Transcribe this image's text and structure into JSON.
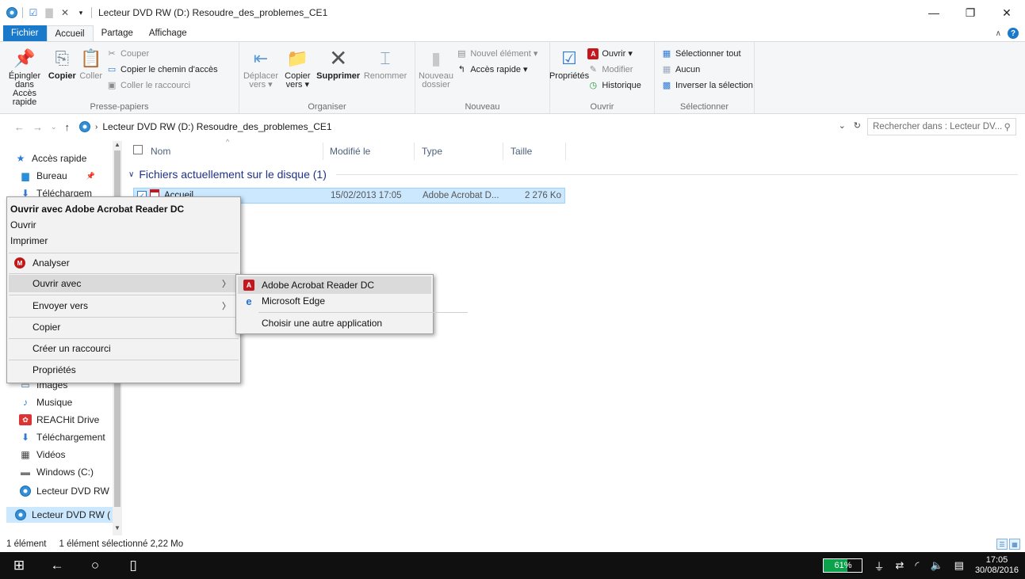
{
  "window": {
    "title": "Lecteur DVD RW (D:) Resoudre_des_problemes_CE1",
    "controls": {
      "minimize": "—",
      "maximize": "❐",
      "close": "✕"
    }
  },
  "tabs": [
    {
      "label": "Fichier"
    },
    {
      "label": "Accueil"
    },
    {
      "label": "Partage"
    },
    {
      "label": "Affichage"
    }
  ],
  "ribbon": {
    "clipboard": {
      "label": "Presse-papiers",
      "pin": "Épingler dans Accès rapide",
      "copy": "Copier",
      "paste": "Coller",
      "cut": "Couper",
      "copy_path": "Copier le chemin d'accès",
      "paste_shortcut": "Coller le raccourci"
    },
    "organize": {
      "label": "Organiser",
      "move": "Déplacer vers ▾",
      "copy_to": "Copier vers ▾",
      "delete": "Supprimer",
      "rename": "Renommer"
    },
    "new": {
      "label": "Nouveau",
      "new_folder": "Nouveau dossier",
      "new_item": "Nouvel élément ▾",
      "quick_access": "Accès rapide ▾"
    },
    "open": {
      "label": "Ouvrir",
      "properties": "Propriétés",
      "open": "Ouvrir ▾",
      "edit": "Modifier",
      "history": "Historique"
    },
    "select": {
      "label": "Sélectionner",
      "select_all": "Sélectionner tout",
      "select_none": "Aucun",
      "invert": "Inverser la sélection"
    }
  },
  "address": {
    "path": "Lecteur DVD RW (D:) Resoudre_des_problemes_CE1",
    "search_placeholder": "Rechercher dans : Lecteur DV..."
  },
  "nav_pane": [
    {
      "label": "Accès rapide"
    },
    {
      "label": "Bureau"
    },
    {
      "label": "Téléchargem"
    },
    {
      "label": "Images"
    },
    {
      "label": "Musique"
    },
    {
      "label": "REACHit Drive"
    },
    {
      "label": "Téléchargement"
    },
    {
      "label": "Vidéos"
    },
    {
      "label": "Windows (C:)"
    },
    {
      "label": "Lecteur DVD RW"
    },
    {
      "label": "Lecteur DVD RW ("
    }
  ],
  "columns": {
    "name": "Nom",
    "modified": "Modifié le",
    "type": "Type",
    "size": "Taille"
  },
  "group": {
    "label": "Fichiers actuellement sur le disque (1)"
  },
  "file": {
    "name": "Accueil",
    "modified": "15/02/2013 17:05",
    "type": "Adobe Acrobat D...",
    "size": "2 276 Ko"
  },
  "context_menu": {
    "open_with_default": "Ouvrir avec Adobe Acrobat Reader DC",
    "open": "Ouvrir",
    "print": "Imprimer",
    "scan": "Analyser",
    "open_with": "Ouvrir avec",
    "send_to": "Envoyer vers",
    "copy": "Copier",
    "create_shortcut": "Créer un raccourci",
    "properties": "Propriétés"
  },
  "submenu": {
    "acrobat": "Adobe Acrobat Reader DC",
    "edge": "Microsoft Edge",
    "other": "Choisir une autre application"
  },
  "status": {
    "count": "1 élément",
    "selected": "1 élément sélectionné 2,22 Mo"
  },
  "taskbar": {
    "battery": "61%",
    "battery_level": 0.61,
    "time": "17:05",
    "date": "30/08/2016"
  },
  "colors": {
    "accent": "#1979ca",
    "selection": "#cce8ff",
    "group_header": "#1e3287",
    "battery": "#0aa24a"
  }
}
